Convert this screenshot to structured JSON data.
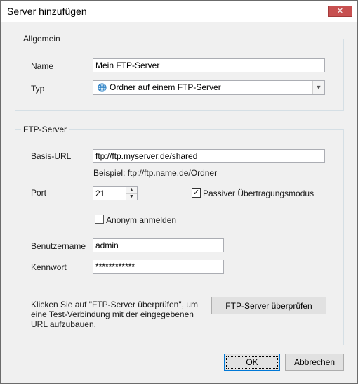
{
  "window": {
    "title": "Server hinzufügen",
    "close_glyph": "✕"
  },
  "general": {
    "legend": "Allgemein",
    "name_label": "Name",
    "name_value": "Mein FTP-Server",
    "type_label": "Typ",
    "type_value": "Ordner auf einem FTP-Server",
    "type_icon": "globe-icon"
  },
  "ftp": {
    "legend": "FTP-Server",
    "base_url_label": "Basis-URL",
    "base_url_value": "ftp://ftp.myserver.de/shared",
    "base_url_hint": "Beispiel: ftp://ftp.name.de/Ordner",
    "port_label": "Port",
    "port_value": "21",
    "passive_label": "Passiver Übertragungsmodus",
    "passive_checked": true,
    "anonymous_label": "Anonym anmelden",
    "anonymous_checked": false,
    "username_label": "Benutzername",
    "username_value": "admin",
    "password_label": "Kennwort",
    "password_value": "************",
    "check_info": "Klicken Sie auf \"FTP-Server überprüfen\", um eine Test-Verbindung mit der eingegebenen URL aufzubauen.",
    "check_button": "FTP-Server überprüfen"
  },
  "footer": {
    "ok_label": "OK",
    "cancel_label": "Abbrechen"
  },
  "colors": {
    "accent": "#0078d7",
    "close": "#c75050"
  }
}
